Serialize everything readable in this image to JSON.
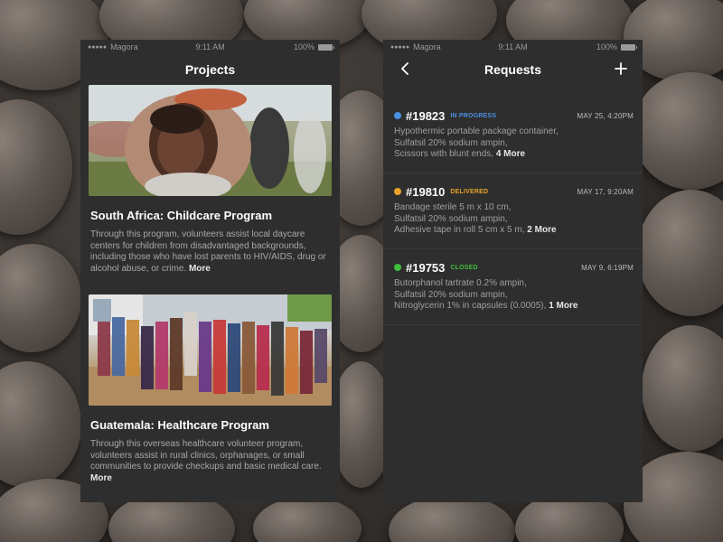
{
  "colors": {
    "panel_bg": "#2e2e2e",
    "in_progress": "#4a90e2",
    "delivered": "#e8a22a",
    "closed": "#3fbf3f"
  },
  "status_bar": {
    "carrier": "Magora",
    "time": "9:11 AM",
    "battery": "100%"
  },
  "projects_screen": {
    "title": "Projects",
    "cards": [
      {
        "title": "South Africa: Childcare Program",
        "description": "Through this program, volunteers assist local daycare centers for children from disadvantaged backgrounds, including those who have lost parents to HIV/AIDS, drug or alcohol abuse, or crime.",
        "more": "More"
      },
      {
        "title": "Guatemala: Healthcare Program",
        "description": "Through this overseas healthcare volunteer program, volunteers assist in rural clinics, orphanages, or small communities to provide checkups and basic medical care.",
        "more": "More"
      }
    ]
  },
  "requests_screen": {
    "title": "Requests",
    "back_icon": "chevron-left-icon",
    "add_icon": "plus-icon",
    "requests": [
      {
        "id": "#19823",
        "status": "IN PROGRESS",
        "date": "MAY 25, 4:20PM",
        "items": [
          "Hypothermic portable package container,",
          "Sulfatsil 20% sodium ampin,",
          "Scissors with blunt ends,"
        ],
        "more": "4 More"
      },
      {
        "id": "#19810",
        "status": "DELIVERED",
        "date": "MAY 17, 9:20AM",
        "items": [
          "Bandage sterile 5 m x 10 cm,",
          "Sulfatsil 20% sodium ampin,",
          "Adhesive tape in roll 5 cm x 5 m,"
        ],
        "more": "2 More"
      },
      {
        "id": "#19753",
        "status": "CLOSED",
        "date": "MAY 9, 6:19PM",
        "items": [
          "Butorphanol tartrate 0.2% ampin,",
          "Sulfatsil 20% sodium ampin,",
          "Nitroglycerin 1% in capsules (0.0005),"
        ],
        "more": "1 More"
      }
    ]
  }
}
